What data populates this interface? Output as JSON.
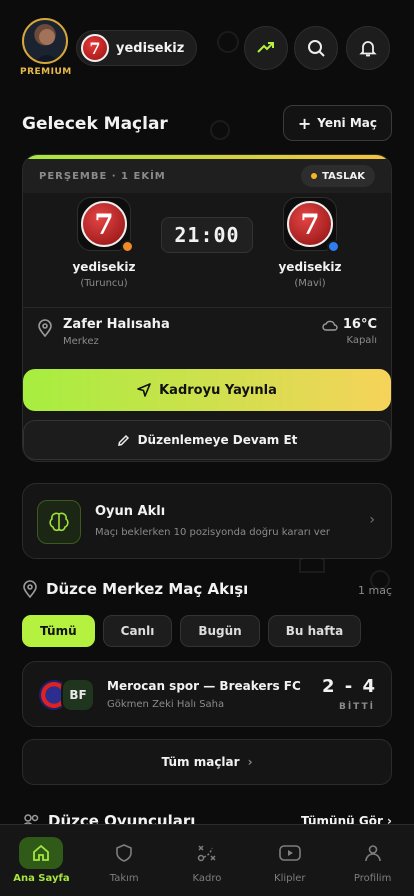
{
  "header": {
    "premium_label": "PREMIUM",
    "team_badge": "7",
    "team_name": "yedisekiz"
  },
  "upcoming": {
    "title": "Gelecek Maçlar",
    "new_match_label": "Yeni Maç",
    "card": {
      "date": "PERŞEMBE · 1 EKİM",
      "status": "TASLAK",
      "home": {
        "badge": "7",
        "name": "yedisekiz",
        "color_label": "(Turuncu)",
        "color": "#f08a24"
      },
      "away": {
        "badge": "7",
        "name": "yedisekiz",
        "color_label": "(Mavi)",
        "color": "#2f7df0"
      },
      "time": "21:00",
      "venue": {
        "name": "Zafer Halısaha",
        "area": "Merkez"
      },
      "weather": {
        "temp": "16°C",
        "condition": "Kapalı"
      },
      "publish_label": "Kadroyu Yayınla",
      "continue_label": "Düzenlemeye Devam Et"
    }
  },
  "mind": {
    "title": "Oyun Aklı",
    "subtitle": "Maçı beklerken 10 pozisyonda doğru kararı ver"
  },
  "feed": {
    "title": "Düzce Merkez Maç Akışı",
    "count": "1 maç",
    "filters": [
      "Tümü",
      "Canlı",
      "Bugün",
      "Bu hafta"
    ],
    "match": {
      "logo_b": "BF",
      "name": "Merocan spor — Breakers FC",
      "place": "Gökmen Zeki Halı Saha",
      "score": "2 - 4",
      "status": "BİTTİ"
    },
    "all_label": "Tüm maçlar"
  },
  "players": {
    "title": "Düzce Oyuncuları",
    "see_all": "Tümünü Gör"
  },
  "tabs": [
    {
      "label": "Ana Sayfa",
      "icon": "home-icon"
    },
    {
      "label": "Takım",
      "icon": "shield-icon"
    },
    {
      "label": "Kadro",
      "icon": "tactics-icon"
    },
    {
      "label": "Klipler",
      "icon": "play-icon"
    },
    {
      "label": "Profilim",
      "icon": "user-icon"
    }
  ],
  "colors": {
    "accent": "#b5f23f",
    "gold": "#e6b94a"
  }
}
